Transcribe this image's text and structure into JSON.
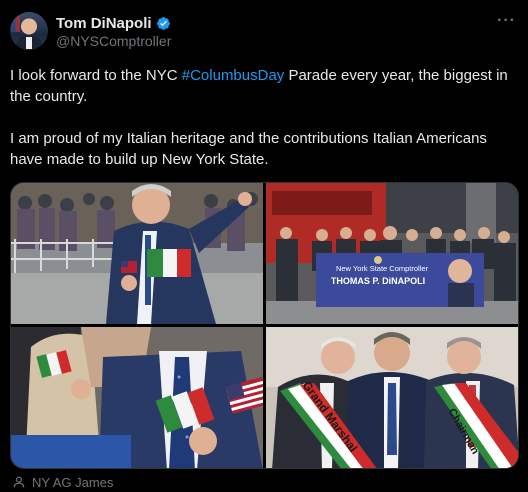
{
  "author": {
    "display_name": "Tom DiNapoli",
    "handle": "@NYSComptroller",
    "verified": true,
    "avatar_icon": "profile-photo"
  },
  "menu": {
    "more_label": "···"
  },
  "tweet": {
    "line1_before": "I look forward to the NYC ",
    "hashtag": "#ColumbusDay",
    "line1_after": " Parade every year, the biggest in the country.",
    "paragraph2": "I am proud of my Italian heritage and the contributions Italian Americans have made to build up New York State."
  },
  "media": {
    "banner_line1": "New York State Comptroller",
    "banner_line2": "THOMAS P. DiNAPOLI",
    "sash_left": "Grand Marshal",
    "sash_right": "Chairman"
  },
  "tagged": {
    "label": "NY AG James",
    "icon": "person-icon"
  },
  "colors": {
    "accent": "#1d9bf0",
    "muted": "#71767b",
    "text": "#e7e9ea",
    "background": "#000000"
  }
}
